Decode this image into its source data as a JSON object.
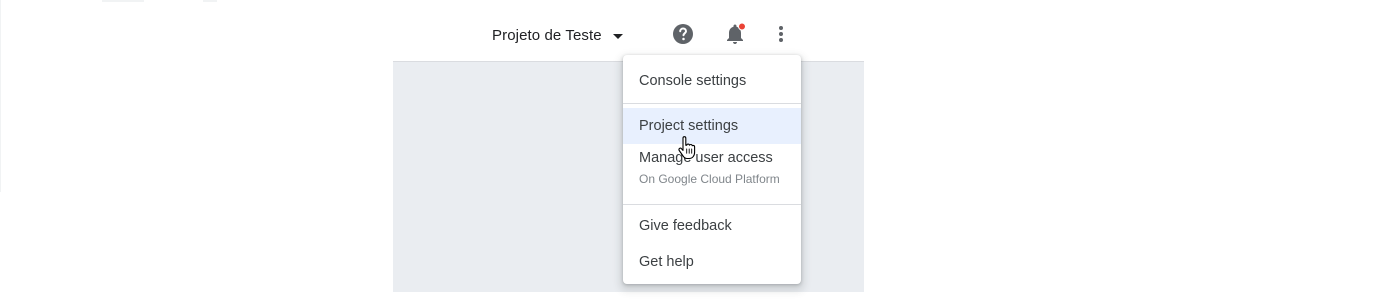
{
  "header": {
    "project_name": "Projeto de Teste",
    "notification_badge_color": "#ea4335"
  },
  "icons": {
    "project_dropdown": "caret-down-icon",
    "help": "help-icon",
    "notifications": "bell-icon",
    "more": "more-vert-icon"
  },
  "menu": {
    "items": [
      {
        "label": "Console settings"
      },
      {
        "label": "Project settings",
        "highlighted": true
      },
      {
        "label": "Manage user access",
        "sublabel": "On Google Cloud Platform"
      },
      {
        "label": "Give feedback"
      },
      {
        "label": "Get help"
      }
    ]
  },
  "colors": {
    "menu_highlight": "#e8f0fe",
    "content_background": "#eaedf1",
    "icon_gray": "#5f6368"
  }
}
